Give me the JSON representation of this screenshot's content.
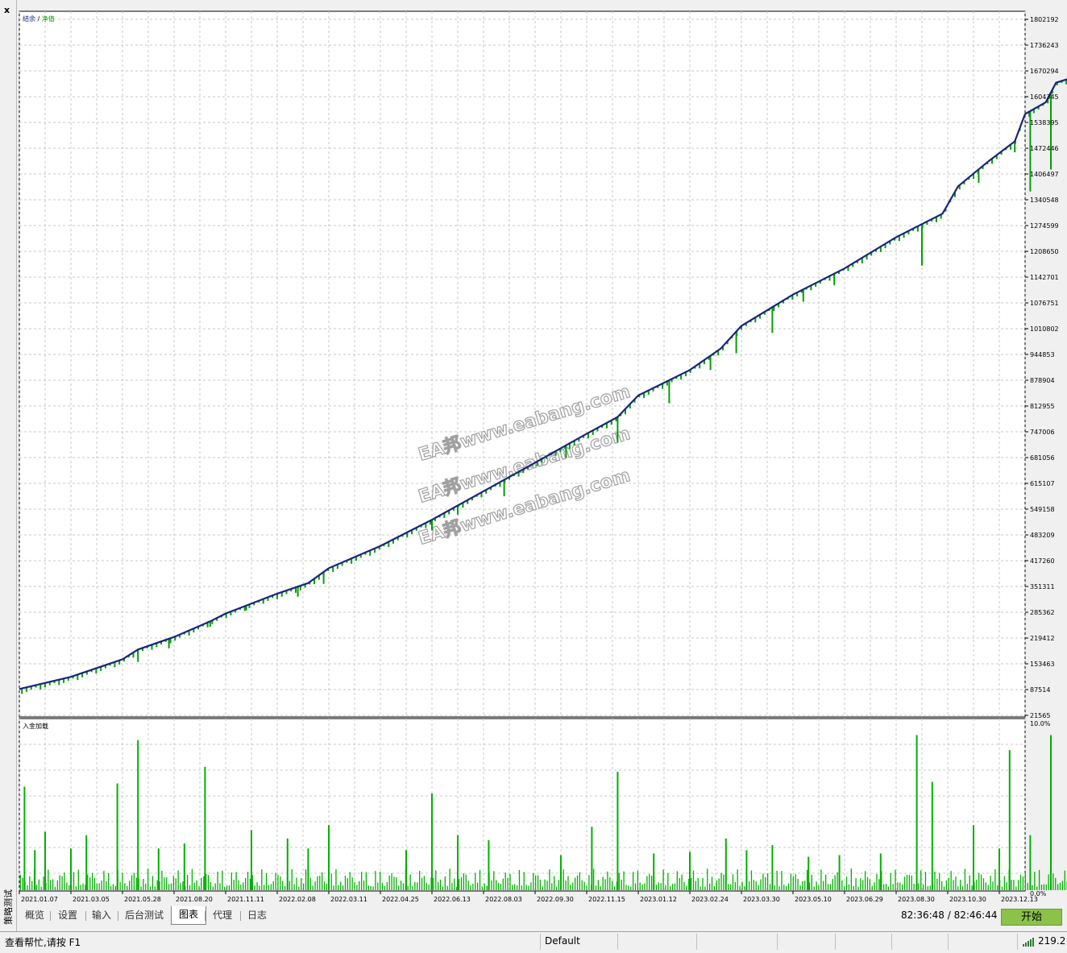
{
  "sidebar": {
    "close_label": "x",
    "vertical_label": "策略测试"
  },
  "legend": {
    "balance": "结余",
    "separator": " / ",
    "equity": "净值"
  },
  "lower_panel_label": "入金加载",
  "tabs": [
    {
      "label": "概览",
      "active": false
    },
    {
      "label": "设置",
      "active": false
    },
    {
      "label": "输入",
      "active": false
    },
    {
      "label": "后台测试",
      "active": false
    },
    {
      "label": "图表",
      "active": true
    },
    {
      "label": "代理",
      "active": false
    },
    {
      "label": "日志",
      "active": false
    }
  ],
  "timer": "82:36:48 / 82:46:44",
  "start_button": "开始",
  "status": {
    "help": "查看帮忙,请按 F1",
    "profile": "Default",
    "connection": "219.2"
  },
  "watermark": "EA邦www.eabang.com",
  "colors": {
    "balance": "#1a237e",
    "equity": "#00a000",
    "load": "#00b000",
    "grid": "#c8c8c8",
    "start_button": "#8bc34a"
  },
  "icons": {
    "close": "close-icon",
    "signal": "signal-bars-icon"
  },
  "chart_data": [
    {
      "type": "line",
      "series": [
        {
          "name": "结余",
          "color": "#1a237e"
        },
        {
          "name": "净值",
          "color": "#00a000"
        }
      ],
      "ylim": [
        21565,
        1835000
      ],
      "yticks": [
        21565,
        87514,
        153463,
        219412,
        285362,
        351311,
        417260,
        483209,
        549158,
        615107,
        681056,
        747006,
        812955,
        878904,
        944853,
        1010802,
        1076751,
        1142701,
        1208650,
        1274599,
        1340548,
        1406497,
        1472446,
        1538395,
        1604345,
        1670294,
        1736243,
        1802192
      ],
      "x_dates": [
        "2021.01.07",
        "2021.03.05",
        "2021.05.28",
        "2021.08.20",
        "2021.11.11",
        "2022.02.08",
        "2022.03.11",
        "2022.04.25",
        "2022.06.13",
        "2022.08.03",
        "2022.09.30",
        "2022.11.15",
        "2023.01.12",
        "2023.02.24",
        "2023.03.30",
        "2023.05.10",
        "2023.06.29",
        "2023.08.30",
        "2023.10.30",
        "2023.12.13"
      ],
      "balance_path": [
        [
          0,
          89000
        ],
        [
          1,
          120000
        ],
        [
          2,
          165000
        ],
        [
          2.3,
          190000
        ],
        [
          3,
          222000
        ],
        [
          3.7,
          262000
        ],
        [
          4,
          282000
        ],
        [
          5,
          333000
        ],
        [
          5.6,
          360000
        ],
        [
          6,
          398000
        ],
        [
          7,
          455000
        ],
        [
          8,
          522000
        ],
        [
          9,
          595000
        ],
        [
          10,
          668000
        ],
        [
          11,
          742000
        ],
        [
          11.6,
          785000
        ],
        [
          12,
          840000
        ],
        [
          13,
          905000
        ],
        [
          13.6,
          960000
        ],
        [
          14,
          1018000
        ],
        [
          15,
          1098000
        ],
        [
          16,
          1165000
        ],
        [
          17,
          1245000
        ],
        [
          17.9,
          1305000
        ],
        [
          18.2,
          1375000
        ],
        [
          18.8,
          1440000
        ],
        [
          19.3,
          1490000
        ],
        [
          19.5,
          1560000
        ],
        [
          19.9,
          1590000
        ],
        [
          20.1,
          1640000
        ],
        [
          20.7,
          1665000
        ]
      ],
      "equity_dips": [
        [
          0.8,
          112000
        ],
        [
          1.3,
          130000
        ],
        [
          2.3,
          158000
        ],
        [
          2.9,
          193000
        ],
        [
          3.7,
          248000
        ],
        [
          4.4,
          290000
        ],
        [
          5.4,
          325000
        ],
        [
          5.9,
          358000
        ],
        [
          6.8,
          440000
        ],
        [
          8,
          495000
        ],
        [
          8.5,
          535000
        ],
        [
          9.4,
          582000
        ],
        [
          10.6,
          680000
        ],
        [
          11.6,
          720000
        ],
        [
          12.6,
          820000
        ],
        [
          13.4,
          905000
        ],
        [
          13.9,
          948000
        ],
        [
          14.6,
          1000000
        ],
        [
          15.2,
          1080000
        ],
        [
          15.8,
          1122000
        ],
        [
          17.5,
          1172000
        ],
        [
          17.8,
          1296000
        ],
        [
          18.6,
          1384000
        ],
        [
          19.3,
          1462000
        ],
        [
          19.6,
          1362000
        ],
        [
          20.0,
          1418000
        ]
      ]
    },
    {
      "type": "bar",
      "title": "入金加载",
      "ylim": [
        0,
        10
      ],
      "yticks": [
        "0.0%",
        "10.0%"
      ],
      "spikes": [
        [
          0.1,
          6.2
        ],
        [
          0.3,
          2.4
        ],
        [
          0.5,
          3.5
        ],
        [
          1.0,
          2.5
        ],
        [
          1.3,
          3.3
        ],
        [
          1.9,
          6.4
        ],
        [
          2.3,
          9.0
        ],
        [
          2.7,
          2.5
        ],
        [
          3.2,
          2.8
        ],
        [
          3.6,
          7.4
        ],
        [
          4.5,
          3.6
        ],
        [
          5.2,
          3.1
        ],
        [
          5.6,
          2.5
        ],
        [
          6.0,
          3.9
        ],
        [
          7.5,
          2.4
        ],
        [
          8.0,
          5.8
        ],
        [
          8.5,
          3.3
        ],
        [
          9.1,
          3.0
        ],
        [
          10.5,
          2.1
        ],
        [
          11.1,
          3.8
        ],
        [
          11.6,
          7.1
        ],
        [
          12.3,
          2.2
        ],
        [
          13.0,
          2.3
        ],
        [
          13.7,
          3.1
        ],
        [
          14.1,
          2.4
        ],
        [
          14.6,
          2.7
        ],
        [
          15.3,
          2.0
        ],
        [
          15.9,
          2.1
        ],
        [
          16.7,
          2.2
        ],
        [
          17.4,
          9.3
        ],
        [
          17.7,
          6.5
        ],
        [
          18.5,
          3.9
        ],
        [
          19.0,
          2.5
        ],
        [
          19.2,
          8.4
        ],
        [
          19.6,
          3.3
        ],
        [
          20.0,
          9.3
        ]
      ]
    }
  ]
}
